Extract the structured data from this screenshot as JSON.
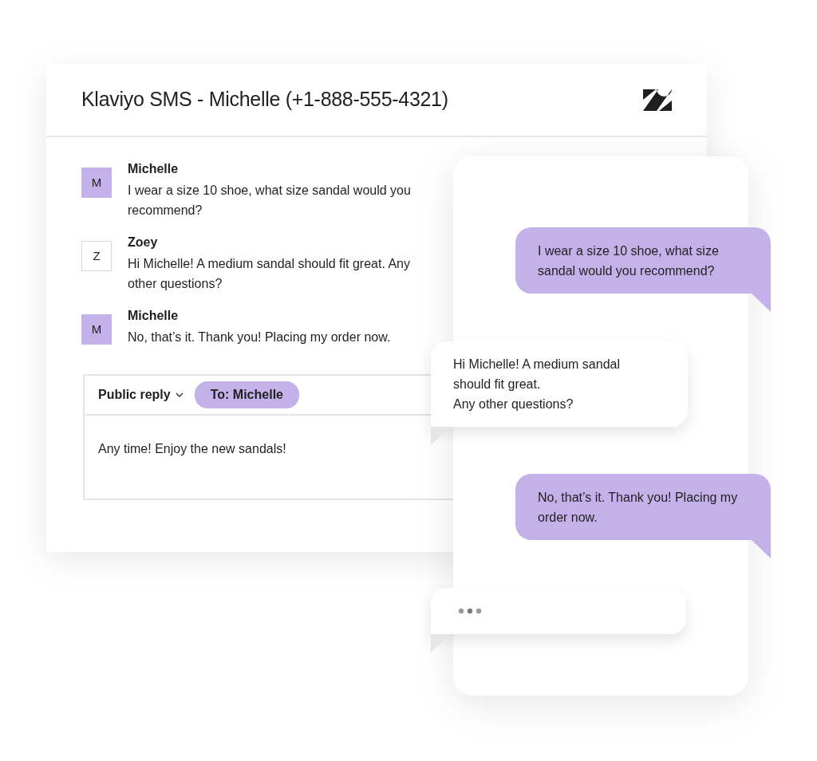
{
  "ticket": {
    "title": "Klaviyo SMS - Michelle (+1-888-555-4321)",
    "messages": [
      {
        "kind": "customer",
        "initial": "M",
        "author": "Michelle",
        "text": "I wear a size 10 shoe, what size sandal would you recommend?"
      },
      {
        "kind": "agent",
        "initial": "Z",
        "author": "Zoey",
        "text": "Hi Michelle! A medium sandal should fit great. Any other questions?"
      },
      {
        "kind": "customer",
        "initial": "M",
        "author": "Michelle",
        "text": "No, that’s it. Thank you! Placing my order now."
      }
    ],
    "reply": {
      "mode": "Public reply",
      "recipient": "To: Michelle",
      "text": "Any time! Enjoy the new sandals!"
    }
  },
  "phone": {
    "bubbles": [
      {
        "kind": "outgoing",
        "text": "I wear a size 10 shoe, what size sandal would you recommend?"
      },
      {
        "kind": "incoming",
        "text": "Hi Michelle! A medium sandal\nshould fit great.\nAny other questions?"
      },
      {
        "kind": "outgoing",
        "text": "No, that’s it. Thank you! Placing my order now."
      },
      {
        "kind": "typing"
      }
    ]
  }
}
